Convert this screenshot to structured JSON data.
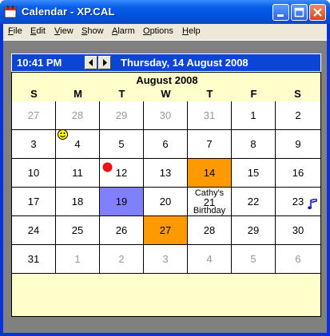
{
  "window": {
    "title": "Calendar - XP.CAL"
  },
  "menu": [
    {
      "pre": "",
      "u": "F",
      "post": "ile"
    },
    {
      "pre": "",
      "u": "E",
      "post": "dit"
    },
    {
      "pre": "",
      "u": "V",
      "post": "iew"
    },
    {
      "pre": "",
      "u": "S",
      "post": "how"
    },
    {
      "pre": "",
      "u": "A",
      "post": "larm"
    },
    {
      "pre": "",
      "u": "O",
      "post": "ptions"
    },
    {
      "pre": "",
      "u": "H",
      "post": "elp"
    }
  ],
  "topbar": {
    "time": "10:41 PM",
    "date": "Thursday, 14 August 2008"
  },
  "calendar": {
    "month": "August 2008",
    "days": [
      "S",
      "M",
      "T",
      "W",
      "T",
      "F",
      "S"
    ],
    "weeks": [
      [
        {
          "n": "27",
          "dim": true
        },
        {
          "n": "28",
          "dim": true
        },
        {
          "n": "29",
          "dim": true
        },
        {
          "n": "30",
          "dim": true
        },
        {
          "n": "31",
          "dim": true
        },
        {
          "n": "1"
        },
        {
          "n": "2"
        }
      ],
      [
        {
          "n": "3"
        },
        {
          "n": "4",
          "mark": "smiley-icon"
        },
        {
          "n": "5"
        },
        {
          "n": "6"
        },
        {
          "n": "7"
        },
        {
          "n": "8"
        },
        {
          "n": "9"
        }
      ],
      [
        {
          "n": "10"
        },
        {
          "n": "11"
        },
        {
          "n": "12",
          "mark": "red-dot-icon"
        },
        {
          "n": "13"
        },
        {
          "n": "14",
          "state": "today"
        },
        {
          "n": "15"
        },
        {
          "n": "16"
        }
      ],
      [
        {
          "n": "17"
        },
        {
          "n": "18"
        },
        {
          "n": "19",
          "state": "selected"
        },
        {
          "n": "20"
        },
        {
          "n": "21",
          "note": [
            "Cathy's",
            "Birthday"
          ]
        },
        {
          "n": "22"
        },
        {
          "n": "23",
          "mark": "music-note-icon"
        }
      ],
      [
        {
          "n": "24"
        },
        {
          "n": "25"
        },
        {
          "n": "26"
        },
        {
          "n": "27",
          "state": "today"
        },
        {
          "n": "28"
        },
        {
          "n": "29"
        },
        {
          "n": "30"
        }
      ],
      [
        {
          "n": "31"
        },
        {
          "n": "1",
          "dim": true
        },
        {
          "n": "2",
          "dim": true
        },
        {
          "n": "3",
          "dim": true
        },
        {
          "n": "4",
          "dim": true
        },
        {
          "n": "5",
          "dim": true
        },
        {
          "n": "6",
          "dim": true
        }
      ]
    ]
  },
  "colors": {
    "titlebar": "#0054e3",
    "topbar": "#0a45d8",
    "calendar_bg": "#ffffcc",
    "today": "#ff9900",
    "selected": "#8080ff"
  }
}
